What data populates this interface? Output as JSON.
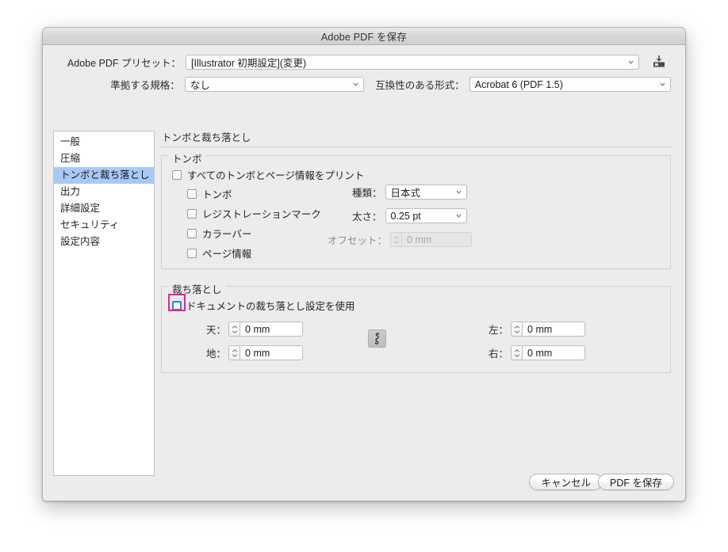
{
  "window": {
    "title": "Adobe PDF を保存"
  },
  "top": {
    "preset_label": "Adobe PDF プリセット：",
    "preset_value": "[Illustrator 初期設定](変更)",
    "standard_label": "準拠する規格：",
    "standard_value": "なし",
    "compatibility_label": "互換性のある形式：",
    "compatibility_value": "Acrobat 6 (PDF 1.5)",
    "save_preset_icon": "save-preset-icon"
  },
  "sidebar": {
    "items": [
      {
        "label": "一般",
        "selected": false
      },
      {
        "label": "圧縮",
        "selected": false
      },
      {
        "label": "トンボと裁ち落とし",
        "selected": true
      },
      {
        "label": "出力",
        "selected": false
      },
      {
        "label": "詳細設定",
        "selected": false
      },
      {
        "label": "セキュリティ",
        "selected": false
      },
      {
        "label": "設定内容",
        "selected": false
      }
    ]
  },
  "panel": {
    "title": "トンボと裁ち落とし",
    "marks": {
      "legend": "トンボ",
      "print_all_label": "すべてのトンボとページ情報をプリント",
      "print_all_checked": false,
      "options": [
        {
          "label": "トンボ",
          "checked": false
        },
        {
          "label": "レジストレーションマーク",
          "checked": false
        },
        {
          "label": "カラーバー",
          "checked": false
        },
        {
          "label": "ページ情報",
          "checked": false
        }
      ],
      "type_label": "種類：",
      "type_value": "日本式",
      "weight_label": "太さ：",
      "weight_value": "0.25 pt",
      "offset_label": "オフセット：",
      "offset_value": "0 mm",
      "offset_disabled": true
    },
    "bleed": {
      "legend": "裁ち落とし",
      "use_document_label": "ドキュメントの裁ち落とし設定を使用",
      "use_document_checked": false,
      "top_label": "天：",
      "top_value": "0 mm",
      "bottom_label": "地：",
      "bottom_value": "0 mm",
      "left_label": "左：",
      "left_value": "0 mm",
      "right_label": "右：",
      "right_value": "0 mm",
      "link_icon": "broken-link-icon"
    }
  },
  "footer": {
    "cancel_label": "キャンセル",
    "save_label": "PDF を保存"
  },
  "annotation": {
    "highlight_color": "#ea1e96"
  }
}
